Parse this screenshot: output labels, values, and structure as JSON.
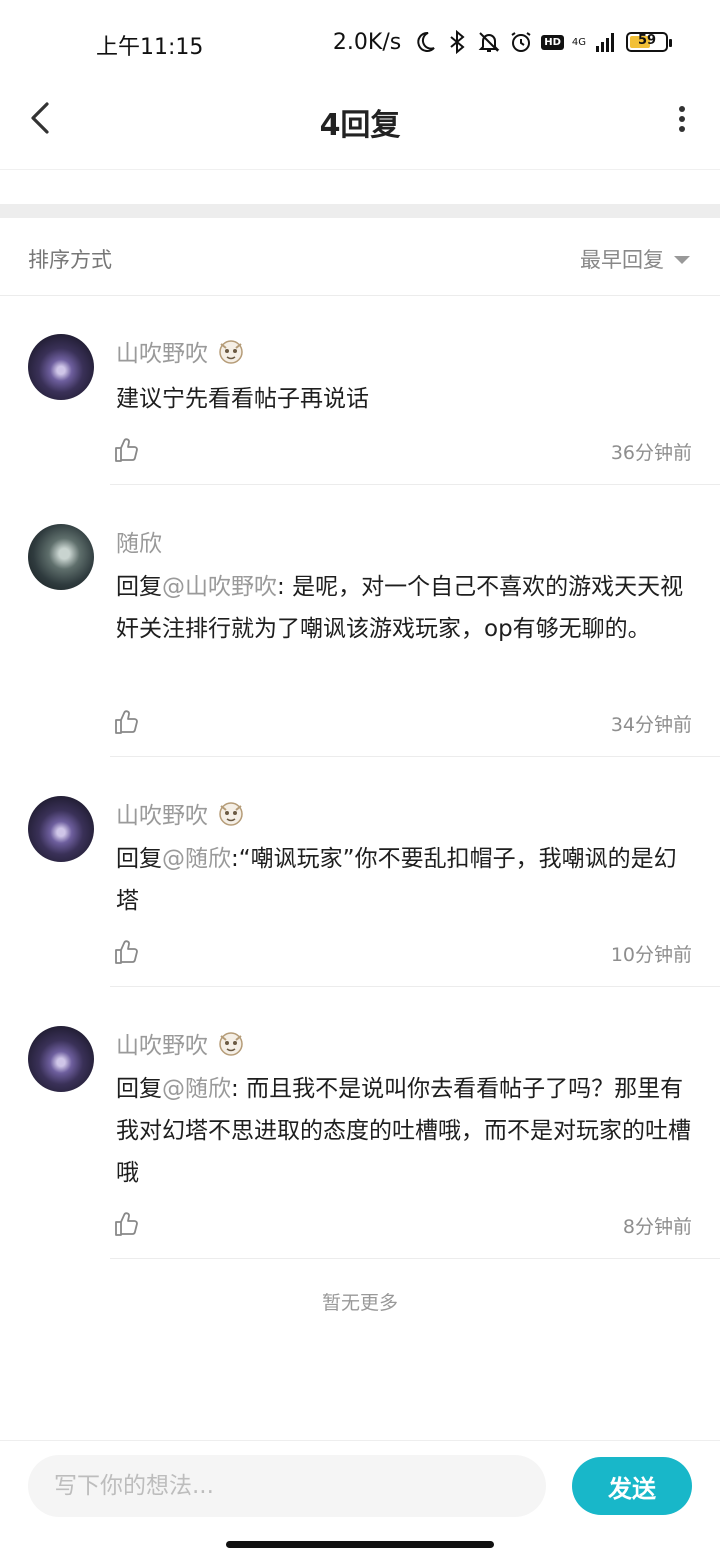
{
  "status_bar": {
    "time": "上午11:15",
    "net_speed": "2.0K/s",
    "network": "4G",
    "hd": "HD",
    "battery": "59",
    "battery_level": 0.59,
    "icons": [
      "moon-icon",
      "bluetooth-icon",
      "mute-icon",
      "alarm-icon",
      "hd-icon",
      "signal-icon",
      "battery-icon"
    ]
  },
  "header": {
    "title": "4回复"
  },
  "sort": {
    "label": "排序方式",
    "selected": "最早回复"
  },
  "replies": [
    {
      "user": "山吹野吹",
      "has_badge": true,
      "prefix": "",
      "mention": "",
      "separator": "",
      "text": "建议宁先看看帖子再说话",
      "time": "36分钟前"
    },
    {
      "user": "随欣",
      "has_badge": false,
      "prefix": "回复",
      "mention": "@山吹野吹",
      "separator": ": ",
      "text": "是呢，对一个自己不喜欢的游戏天天视奸关注排行就为了嘲讽该游戏玩家，op有够无聊的。",
      "time": "34分钟前"
    },
    {
      "user": "山吹野吹",
      "has_badge": true,
      "prefix": "回复",
      "mention": "@随欣",
      "separator": ":",
      "text": "“嘲讽玩家”你不要乱扣帽子，我嘲讽的是幻塔",
      "time": "10分钟前"
    },
    {
      "user": "山吹野吹",
      "has_badge": true,
      "prefix": "回复",
      "mention": "@随欣",
      "separator": ": ",
      "text": "而且我不是说叫你去看看帖子了吗？那里有我对幻塔不思进取的态度的吐槽哦，而不是对玩家的吐槽哦",
      "time": "8分钟前"
    }
  ],
  "no_more": "暂无更多",
  "composer": {
    "placeholder": "写下你的想法...",
    "send_label": "发送"
  },
  "colors": {
    "accent": "#18b7c9",
    "secondary_text": "#9a9a9a"
  }
}
